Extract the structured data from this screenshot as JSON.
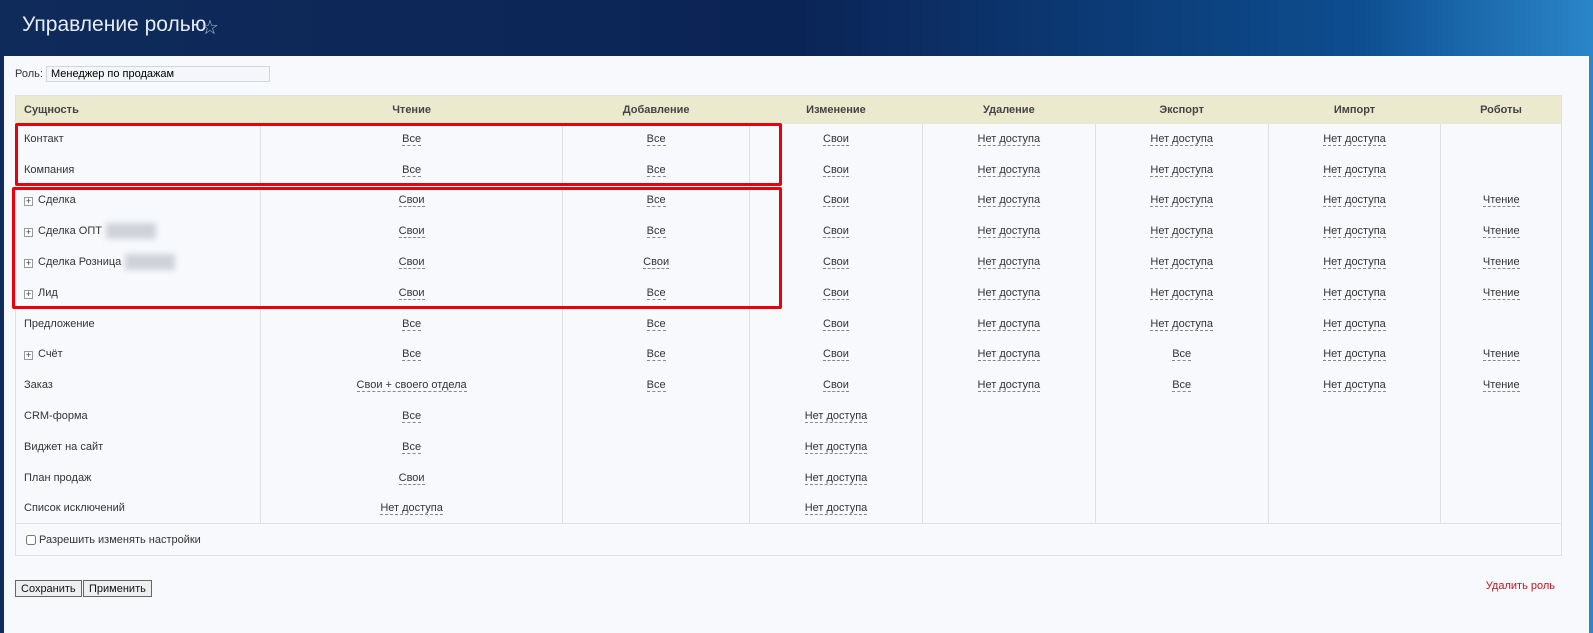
{
  "header": {
    "title": "Управление ролью",
    "star_icon": "star-icon"
  },
  "role": {
    "label": "Роль:",
    "value": "Менеджер по продажам"
  },
  "columns": [
    "Сущность",
    "Чтение",
    "Добавление",
    "Изменение",
    "Удаление",
    "Экспорт",
    "Импорт",
    "Роботы"
  ],
  "rows": [
    {
      "name": "Контакт",
      "expand": false,
      "blur": false,
      "values": [
        "Все",
        "Все",
        "Свои",
        "Нет доступа",
        "Нет доступа",
        "Нет доступа",
        ""
      ]
    },
    {
      "name": "Компания",
      "expand": false,
      "blur": false,
      "values": [
        "Все",
        "Все",
        "Свои",
        "Нет доступа",
        "Нет доступа",
        "Нет доступа",
        ""
      ]
    },
    {
      "name": "Сделка",
      "expand": true,
      "blur": false,
      "values": [
        "Свои",
        "Все",
        "Свои",
        "Нет доступа",
        "Нет доступа",
        "Нет доступа",
        "Чтение"
      ]
    },
    {
      "name": "Сделка ОПТ",
      "expand": true,
      "blur": true,
      "values": [
        "Свои",
        "Все",
        "Свои",
        "Нет доступа",
        "Нет доступа",
        "Нет доступа",
        "Чтение"
      ]
    },
    {
      "name": "Сделка Розница",
      "expand": true,
      "blur": true,
      "values": [
        "Свои",
        "Свои",
        "Свои",
        "Нет доступа",
        "Нет доступа",
        "Нет доступа",
        "Чтение"
      ]
    },
    {
      "name": "Лид",
      "expand": true,
      "blur": false,
      "values": [
        "Свои",
        "Все",
        "Свои",
        "Нет доступа",
        "Нет доступа",
        "Нет доступа",
        "Чтение"
      ]
    },
    {
      "name": "Предложение",
      "expand": false,
      "blur": false,
      "values": [
        "Все",
        "Все",
        "Свои",
        "Нет доступа",
        "Нет доступа",
        "Нет доступа",
        ""
      ]
    },
    {
      "name": "Счёт",
      "expand": true,
      "blur": false,
      "values": [
        "Все",
        "Все",
        "Свои",
        "Нет доступа",
        "Все",
        "Нет доступа",
        "Чтение"
      ]
    },
    {
      "name": "Заказ",
      "expand": false,
      "blur": false,
      "values": [
        "Свои + своего отдела",
        "Все",
        "Свои",
        "Нет доступа",
        "Все",
        "Нет доступа",
        "Чтение"
      ]
    },
    {
      "name": "CRM-форма",
      "expand": false,
      "blur": false,
      "values": [
        "Все",
        "",
        "Нет доступа",
        "",
        "",
        "",
        ""
      ]
    },
    {
      "name": "Виджет на сайт",
      "expand": false,
      "blur": false,
      "values": [
        "Все",
        "",
        "Нет доступа",
        "",
        "",
        "",
        ""
      ]
    },
    {
      "name": "План продаж",
      "expand": false,
      "blur": false,
      "values": [
        "Свои",
        "",
        "Нет доступа",
        "",
        "",
        "",
        ""
      ]
    },
    {
      "name": "Список исключений",
      "expand": false,
      "blur": false,
      "values": [
        "Нет доступа",
        "",
        "Нет доступа",
        "",
        "",
        "",
        ""
      ]
    }
  ],
  "allow_settings": "Разрешить изменять настройки",
  "buttons": {
    "save": "Сохранить",
    "apply": "Применить",
    "delete": "Удалить роль"
  },
  "colors": {
    "highlight": "#e8000d",
    "header_bg": "#ebeacf"
  }
}
